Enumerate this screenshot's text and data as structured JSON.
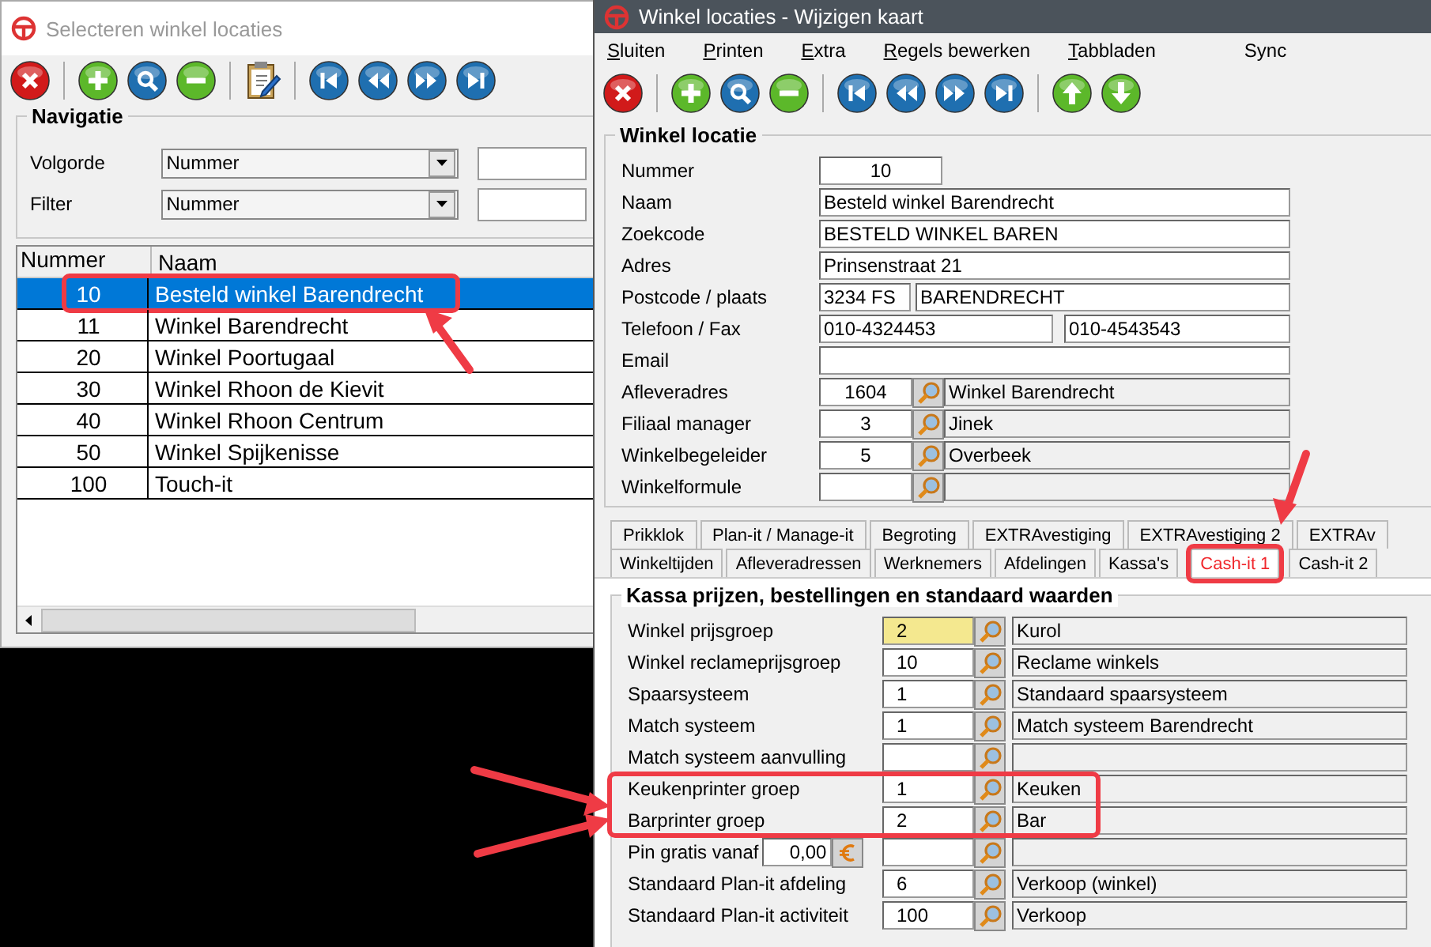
{
  "left_window": {
    "title": "Selecteren winkel locaties",
    "active": false,
    "navigatie": {
      "title": "Navigatie",
      "rows": [
        {
          "label": "Volgorde",
          "value": "Nummer"
        },
        {
          "label": "Filter",
          "value": "Nummer"
        }
      ]
    },
    "table": {
      "columns": [
        "Nummer",
        "Naam"
      ],
      "rows": [
        {
          "cells": [
            "10",
            "Besteld winkel Barendrecht"
          ],
          "selected": true
        },
        {
          "cells": [
            "11",
            "Winkel Barendrecht"
          ],
          "selected": false
        },
        {
          "cells": [
            "20",
            "Winkel Poortugaal"
          ],
          "selected": false
        },
        {
          "cells": [
            "30",
            "Winkel Rhoon de Kievit"
          ],
          "selected": false
        },
        {
          "cells": [
            "40",
            "Winkel Rhoon Centrum"
          ],
          "selected": false
        },
        {
          "cells": [
            "50",
            "Winkel Spijkenisse"
          ],
          "selected": false
        },
        {
          "cells": [
            "100",
            "Touch-it"
          ],
          "selected": false
        }
      ]
    }
  },
  "right_window": {
    "title": "Winkel locaties - Wijzigen kaart",
    "active": true,
    "menu": [
      {
        "label": "Sluiten",
        "mnemonic": true
      },
      {
        "label": "Printen",
        "mnemonic": true
      },
      {
        "label": "Extra",
        "mnemonic": true
      },
      {
        "label": "Regels bewerken",
        "mnemonic": true
      },
      {
        "label": "Tabbladen",
        "mnemonic": true
      },
      {
        "label": "Sync",
        "mnemonic": false
      }
    ],
    "winkel_locatie": {
      "title": "Winkel locatie",
      "fields": [
        {
          "label": "Nummer",
          "kind": "number",
          "value": "10"
        },
        {
          "label": "Naam",
          "kind": "text",
          "value": "Besteld winkel Barendrecht"
        },
        {
          "label": "Zoekcode",
          "kind": "text",
          "value": "BESTELD WINKEL BAREN"
        },
        {
          "label": "Adres",
          "kind": "text",
          "value": "Prinsenstraat 21"
        },
        {
          "label": "Postcode / plaats",
          "kind": "postcode",
          "values": [
            "3234 FS",
            "BARENDRECHT"
          ]
        },
        {
          "label": "Telefoon / Fax",
          "kind": "phone",
          "values": [
            "010-4324453",
            "010-4543543"
          ]
        },
        {
          "label": "Email",
          "kind": "text"
        },
        {
          "label": "Afleveradres",
          "kind": "lookup",
          "code": "1604",
          "description": "Winkel Barendrecht"
        },
        {
          "label": "Filiaal manager",
          "kind": "lookup",
          "code": "3",
          "description": "Jinek"
        },
        {
          "label": "Winkelbegeleider",
          "kind": "lookup",
          "code": "5",
          "description": "Overbeek"
        },
        {
          "label": "Winkelformule",
          "kind": "lookup"
        }
      ]
    },
    "tab_rows": [
      {
        "tabs": [
          {
            "label": "Prikklok",
            "selected": false
          },
          {
            "label": "Plan-it / Manage-it",
            "selected": false
          },
          {
            "label": "Begroting",
            "selected": false
          },
          {
            "label": "EXTRAvestiging",
            "selected": false
          },
          {
            "label": "EXTRAvestiging 2",
            "selected": false
          },
          {
            "label": "EXTRAv",
            "selected": false
          }
        ]
      },
      {
        "tabs": [
          {
            "label": "Winkeltijden",
            "selected": false
          },
          {
            "label": "Afleveradressen",
            "selected": false
          },
          {
            "label": "Werknemers",
            "selected": false
          },
          {
            "label": "Afdelingen",
            "selected": false
          },
          {
            "label": "Kassa's",
            "selected": false
          },
          {
            "label": "Cash-it 1",
            "selected": true
          },
          {
            "label": "Cash-it 2",
            "selected": false
          }
        ]
      }
    ],
    "kassa": {
      "title": "Kassa prijzen, bestellingen en standaard waarden",
      "fields": [
        {
          "label": "Winkel prijsgroep",
          "kind": "lookup",
          "code": "2",
          "description": "Kurol",
          "focused": true
        },
        {
          "label": "Winkel reclameprijsgroep",
          "kind": "lookup",
          "code": "10",
          "description": "Reclame winkels",
          "focused": false
        },
        {
          "label": "Spaarsysteem",
          "kind": "lookup",
          "code": "1",
          "description": "Standaard spaarsysteem",
          "focused": false
        },
        {
          "label": "Match systeem",
          "kind": "lookup",
          "code": "1",
          "description": "Match systeem Barendrecht",
          "focused": false
        },
        {
          "label": "Match systeem aanvulling",
          "kind": "lookup",
          "focused": false
        },
        {
          "label": "Keukenprinter groep",
          "kind": "lookup",
          "code": "1",
          "description": "Keuken",
          "focused": false
        },
        {
          "label": "Barprinter groep",
          "kind": "lookup",
          "code": "2",
          "description": "Bar",
          "focused": false
        },
        {
          "label": "Pin gratis vanaf",
          "kind": "amount",
          "amount": "0,00",
          "focused": false
        },
        {
          "label": "Standaard Plan-it afdeling",
          "kind": "lookup",
          "code": "6",
          "description": "Verkoop (winkel)",
          "focused": false
        },
        {
          "label": "Standaard Plan-it activiteit",
          "kind": "lookup",
          "code": "100",
          "description": "Verkoop",
          "focused": false
        }
      ]
    }
  }
}
